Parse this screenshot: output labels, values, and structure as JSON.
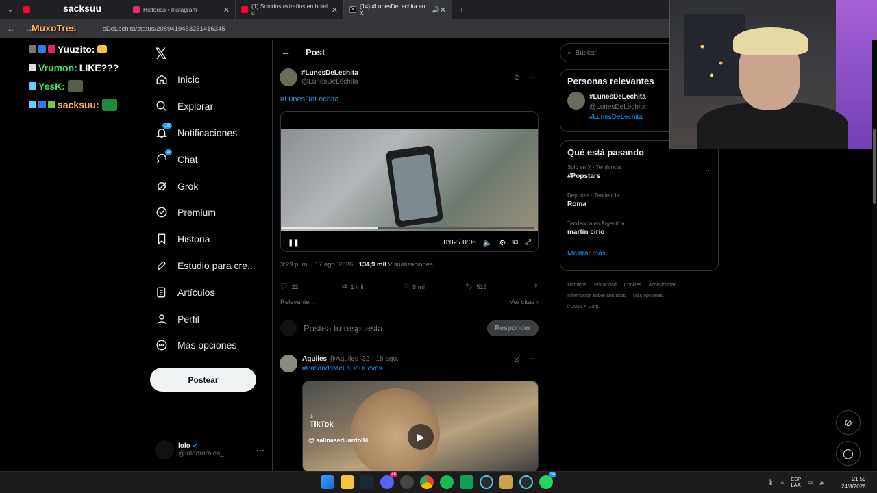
{
  "browser": {
    "tabs": [
      {
        "title": "",
        "favicon_color": "#ff0033"
      },
      {
        "title": "Historias • Instagram",
        "favicon_color": "#e1306c"
      },
      {
        "title": "(1) Sonidos extraños en hotel d",
        "favicon_color": "#ff0033"
      },
      {
        "title": "(14) #LunesDeLechita en X",
        "favicon_color": "#000000"
      }
    ],
    "url": "sDeLechita/status/2089419453251416345"
  },
  "overlay": {
    "streamer": "MuxoTres",
    "tab_overlay_name": "sacksuu",
    "chat": [
      {
        "user": "Yuuzito:",
        "message": "",
        "color": "#ffffff"
      },
      {
        "user": "Vrumon:",
        "message": "LIKE???",
        "color": "#3ce36b"
      },
      {
        "user": "YesK:",
        "message": "",
        "color": "#3ce36b"
      },
      {
        "user": "sacksuu:",
        "message": "",
        "color": "#ffb84d"
      }
    ]
  },
  "x": {
    "logo": "𝕏",
    "nav": [
      {
        "label": "Inicio",
        "icon": "home-icon"
      },
      {
        "label": "Explorar",
        "icon": "search-icon"
      },
      {
        "label": "Notificaciones",
        "icon": "bell-icon",
        "badge": "10"
      },
      {
        "label": "Chat",
        "icon": "chat-icon",
        "badge": "4"
      },
      {
        "label": "Grok",
        "icon": "grok-icon"
      },
      {
        "label": "Premium",
        "icon": "premium-icon"
      },
      {
        "label": "Historia",
        "icon": "bookmark-icon"
      },
      {
        "label": "Estudio para cre...",
        "icon": "rocket-icon"
      },
      {
        "label": "Artículos",
        "icon": "article-icon"
      },
      {
        "label": "Perfil",
        "icon": "person-icon"
      },
      {
        "label": "Más opciones",
        "icon": "more-icon"
      }
    ],
    "post_button": "Postear",
    "account": {
      "name": "lolo",
      "handle": "@lolomorales_"
    }
  },
  "post": {
    "header_title": "Post",
    "author_name": "#LunesDeLechita",
    "author_handle": "@LunesDeLechita",
    "text": "#LunesDeLechita",
    "video": {
      "time": "0:02 / 0:06",
      "progress": 0.38
    },
    "meta_time": "3:29 p. m. · 17 ago. 2026 · ",
    "views_count": "134,9 mil",
    "views_label": " Visualizaciones",
    "stats": {
      "replies": "22",
      "reposts": "1 mil",
      "likes": "8 mil",
      "bookmarks": "516"
    },
    "filter_left": "Relevante",
    "filter_right": "Ver citas",
    "reply_placeholder": "Postea tu respuesta",
    "reply_button": "Responder"
  },
  "reply": {
    "name": "Aquiles",
    "handle": "@Aquiles_32",
    "date": "· 18 ago.",
    "tag": "#PasandoMeLaDeHuevos",
    "tiktok_logo": "TikTok",
    "tiktok_user": "@ salinaseduardo84"
  },
  "sidebar": {
    "search_placeholder": "Buscar",
    "relevant_title": "Personas relevantes",
    "relevant": {
      "name": "#LunesDeLechita",
      "handle": "@LunesDeLechita",
      "bio": "#LunesDeLechita"
    },
    "trending_title": "Qué está pasando",
    "trends": [
      {
        "category": "Solo en X · Tendencia",
        "name": "#Popstars"
      },
      {
        "category": "Deportes · Tendencia",
        "name": "Roma"
      },
      {
        "category": "Tendencia en Argentina",
        "name": "martin cirio"
      }
    ],
    "show_more": "Mostrar más",
    "footer": [
      "Términos",
      "Privacidad",
      "Cookies",
      "Accesibilidad",
      "Información sobre anuncios",
      "Más opciones ···",
      "© 2026 X Corp."
    ]
  },
  "taskbar": {
    "lang_top": "ESP",
    "lang_bottom": "LAA",
    "time": "21:59",
    "date": "24/8/2026",
    "discord_badge": "46",
    "whatsapp_badge": "34"
  }
}
